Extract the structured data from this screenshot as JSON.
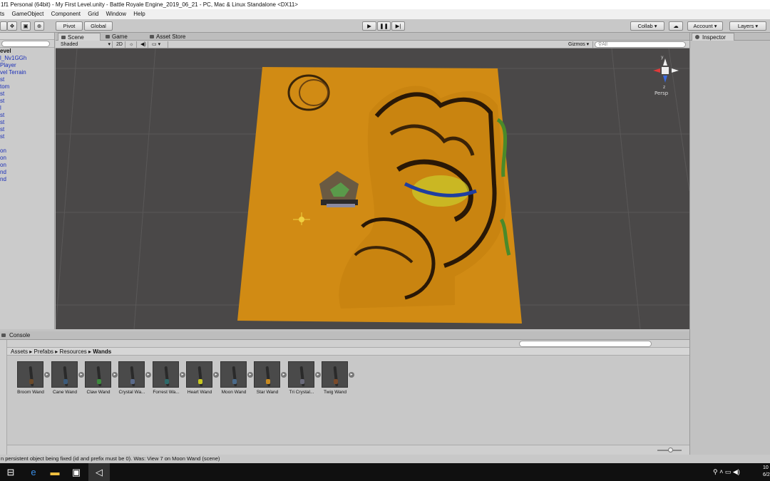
{
  "window": {
    "title": "1f1 Personal (64bit) - My First Level.unity - Battle Royale Engine_2019_06_21 - PC, Mac & Linux Standalone <DX11>"
  },
  "menu": [
    "ts",
    "GameObject",
    "Component",
    "Grid",
    "Window",
    "Help"
  ],
  "toolbar": {
    "pivot": "Pivot",
    "global": "Global",
    "collab": "Collab ▾",
    "account": "Account",
    "layers": "Layers"
  },
  "hierarchy": {
    "root": "evel",
    "items": [
      "l_Nv1GGh",
      "Player",
      "vel Terrain",
      "st",
      "tom",
      "st",
      "st",
      "l",
      "st",
      "st",
      "st",
      "st",
      "",
      "on",
      "on",
      "on",
      "nd",
      "nd"
    ]
  },
  "scene": {
    "tabs": [
      "Scene",
      "Game",
      "Asset Store"
    ],
    "shading": "Shaded",
    "mode_2d": "2D",
    "gizmos": "Gizmos ▾",
    "search_placeholder": "All",
    "persp_label": "Persp",
    "axis_y": "y",
    "axis_z": "z"
  },
  "inspector": {
    "tab": "Inspector"
  },
  "bottom": {
    "console_tab": "Console",
    "breadcrumb": [
      "Assets",
      "Prefabs",
      "Resources",
      "Wands"
    ],
    "assets": [
      {
        "name": "Broom Wand",
        "gem": "#6b4a2a"
      },
      {
        "name": "Cane Wand",
        "gem": "#3b5a7a"
      },
      {
        "name": "Claw Wand",
        "gem": "#3d8a3d"
      },
      {
        "name": "Crystal Wa...",
        "gem": "#5a6a8a"
      },
      {
        "name": "Forrest Wa...",
        "gem": "#2d6a6a"
      },
      {
        "name": "Heart Wand",
        "gem": "#c8c820"
      },
      {
        "name": "Moon Wand",
        "gem": "#4a6a8a"
      },
      {
        "name": "Star Wand",
        "gem": "#c88a20"
      },
      {
        "name": "Tri Crystal...",
        "gem": "#6a6a7a"
      },
      {
        "name": "Twig Wand",
        "gem": "#7a4a2a"
      }
    ]
  },
  "status": {
    "message": "n persistent object being fixed (id and prefix must be 0). Was: View 7 on Moon Wand (scene)"
  },
  "taskbar": {
    "clock_line1": "10",
    "clock_line2": "6/2"
  },
  "colors": {
    "terrain": "#d18b14",
    "hierarchy_link": "#1a2eb8"
  }
}
